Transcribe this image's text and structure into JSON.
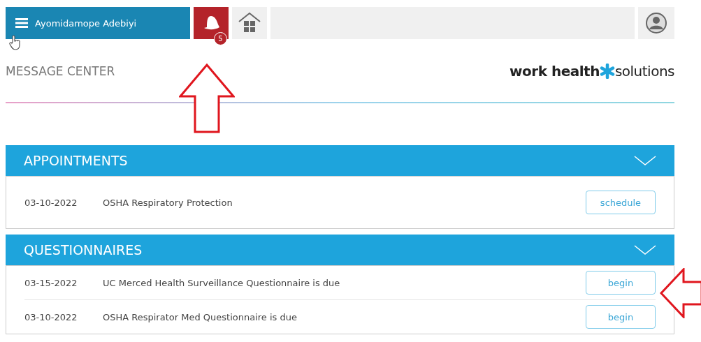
{
  "topbar": {
    "user_name": "Ayomidamope Adebiyi",
    "notification_count": "5"
  },
  "page_title": "MESSAGE CENTER",
  "logo": {
    "part_1": "work health",
    "part_2": "solutions"
  },
  "sections": [
    {
      "title": "APPOINTMENTS",
      "expanded": true,
      "items": [
        {
          "date": "03-10-2022",
          "text": "OSHA Respiratory Protection",
          "action": "schedule"
        }
      ]
    },
    {
      "title": "QUESTIONNAIRES",
      "expanded": true,
      "items": [
        {
          "date": "03-15-2022",
          "text": "UC Merced Health Surveillance Questionnaire is due",
          "action": "begin"
        },
        {
          "date": "03-10-2022",
          "text": "OSHA Respirator Med Questionnaire is due",
          "action": "begin"
        }
      ]
    }
  ]
}
